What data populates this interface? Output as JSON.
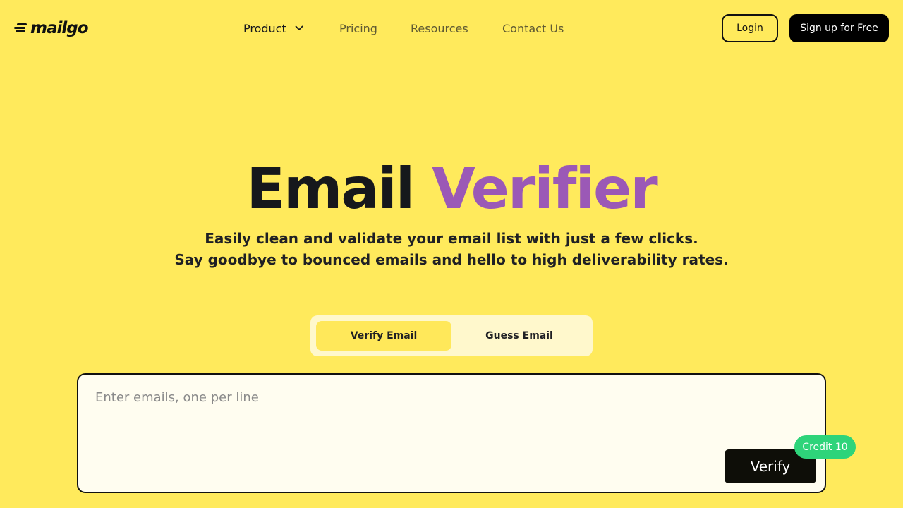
{
  "brand": {
    "name": "mailgo"
  },
  "nav": {
    "items": [
      {
        "label": "Product",
        "icon": "chevron-down-icon"
      },
      {
        "label": "Pricing"
      },
      {
        "label": "Resources"
      },
      {
        "label": "Contact Us"
      }
    ]
  },
  "auth": {
    "login_label": "Login",
    "signup_label": "Sign up for Free"
  },
  "hero": {
    "title_part1": "Email",
    "title_part2": "Verifier",
    "subtitle_line1": "Easily clean and validate your email list with just a few clicks.",
    "subtitle_line2": "Say goodbye to bounced emails and hello to high deliverability rates."
  },
  "tabs": [
    {
      "label": "Verify Email",
      "active": true
    },
    {
      "label": "Guess Email",
      "active": false
    }
  ],
  "verifier": {
    "placeholder": "Enter emails, one per line",
    "value": "",
    "verify_label": "Verify",
    "credit_label": "Credit 10"
  },
  "colors": {
    "background": "#ffea5c",
    "accent_purple": "#9b59b6",
    "credit_green": "#2ed47a",
    "button_dark": "#000000"
  }
}
